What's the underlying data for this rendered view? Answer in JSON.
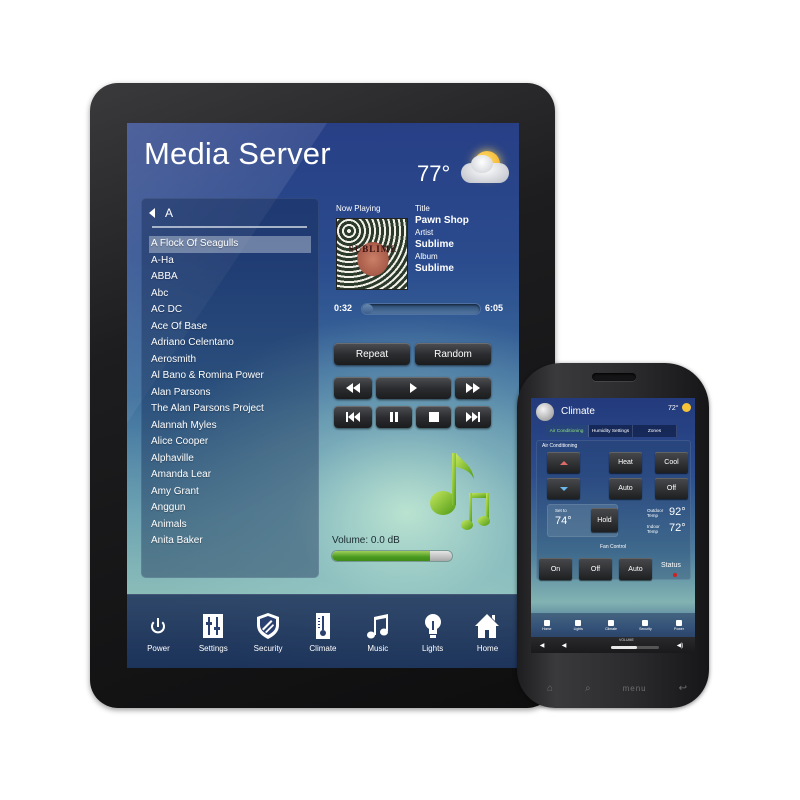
{
  "tablet": {
    "app_title": "Media Server",
    "weather": {
      "temperature": "77°",
      "icon": "partly-cloudy-icon"
    },
    "artist_list": {
      "header_letter": "A",
      "selected_index": 0,
      "items": [
        "A Flock Of Seagulls",
        "A-Ha",
        "ABBA",
        "Abc",
        "AC DC",
        "Ace Of Base",
        "Adriano Celentano",
        "Aerosmith",
        "Al Bano & Romina Power",
        "Alan Parsons",
        "The Alan Parsons Project",
        "Alannah Myles",
        "Alice Cooper",
        "Alphaville",
        "Amanda Lear",
        "Amy Grant",
        "Anggun",
        "Animals",
        "Anita Baker"
      ]
    },
    "now_playing": {
      "label": "Now Playing",
      "album_art_text": "SUBLIME",
      "title_label": "Title",
      "title": "Pawn Shop",
      "artist_label": "Artist",
      "artist": "Sublime",
      "album_label": "Album",
      "album": "Sublime",
      "elapsed": "0:32",
      "duration": "6:05",
      "progress_fraction": 0.09
    },
    "controls": {
      "repeat_label": "Repeat",
      "random_label": "Random",
      "transport": [
        "rewind-icon",
        "play-icon",
        "fast-forward-icon",
        "previous-track-icon",
        "pause-icon",
        "stop-icon",
        "next-track-icon"
      ]
    },
    "volume": {
      "label": "Volume: 0.0 dB",
      "level_fraction": 0.82
    },
    "nav": [
      {
        "label": "Power",
        "icon": "power-icon"
      },
      {
        "label": "Settings",
        "icon": "settings-sliders-icon"
      },
      {
        "label": "Security",
        "icon": "shield-icon"
      },
      {
        "label": "Climate",
        "icon": "thermometer-icon"
      },
      {
        "label": "Music",
        "icon": "music-note-icon"
      },
      {
        "label": "Lights",
        "icon": "lightbulb-icon"
      },
      {
        "label": "Home",
        "icon": "home-icon"
      }
    ]
  },
  "phone": {
    "title": "Climate",
    "temperature": "72°",
    "tabs": [
      {
        "label": "Air Conditioning",
        "active": true
      },
      {
        "label": "Humidity Settings",
        "active": false
      },
      {
        "label": "Zones",
        "active": false
      }
    ],
    "ac_section_label": "Air Conditioning",
    "mode_buttons": {
      "heat": "Heat",
      "cool": "Cool",
      "auto": "Auto",
      "off": "Off"
    },
    "set_to_label": "Set to",
    "set_point": "74°",
    "hold_label": "Hold",
    "outdoor_label": "Outdoor Temp",
    "outdoor_temp": "92°",
    "indoor_label": "Indoor Temp",
    "indoor_temp": "72°",
    "fan_section_label": "Fan Control",
    "fan_buttons": {
      "on": "On",
      "off": "Off",
      "auto": "Auto"
    },
    "status_label": "Status",
    "status_color": "#d12020",
    "nav": [
      "Home",
      "Lights",
      "Climate",
      "Security",
      "Power"
    ],
    "volume_label": "VOLUME",
    "volume_fraction": 0.55,
    "hardware_keys": {
      "home": "⌂",
      "search": "⌕",
      "menu": "menu",
      "back": "↩"
    }
  }
}
